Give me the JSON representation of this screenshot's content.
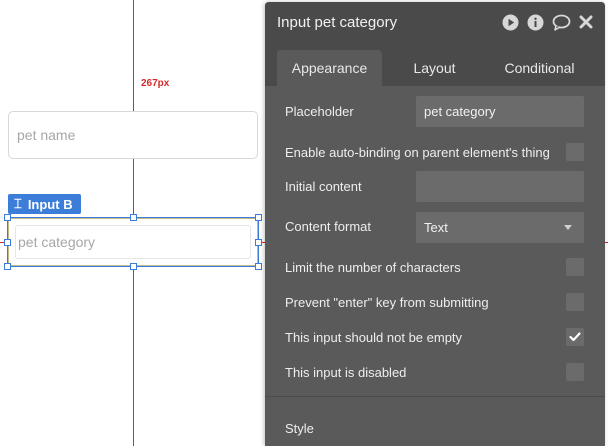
{
  "canvas": {
    "guide_label": "267px",
    "pet_name_placeholder": "pet name",
    "element_tag": "Input B",
    "pet_category_placeholder": "pet category"
  },
  "panel": {
    "title": "Input pet category",
    "icons": [
      "play-icon",
      "info-icon",
      "comment-icon",
      "close-icon"
    ],
    "tabs": [
      "Appearance",
      "Layout",
      "Conditional"
    ],
    "active_tab": "Appearance",
    "placeholder_label": "Placeholder",
    "placeholder_value": "pet category",
    "autobinding_label": "Enable auto-binding on parent element's thing",
    "initial_content_label": "Initial content",
    "initial_content_value": "",
    "content_format_label": "Content format",
    "content_format_value": "Text",
    "limit_chars_label": "Limit the number of characters",
    "prevent_enter_label": "Prevent \"enter\" key from submitting",
    "not_empty_label": "This input should not be empty",
    "not_empty_checked": true,
    "disabled_label": "This input is disabled",
    "style_label": "Style"
  },
  "colors": {
    "panel_bg": "#5a5a5a",
    "panel_header": "#4a4a4a",
    "accent_blue": "#3b7dd8",
    "guide_red": "#d42a2a"
  }
}
